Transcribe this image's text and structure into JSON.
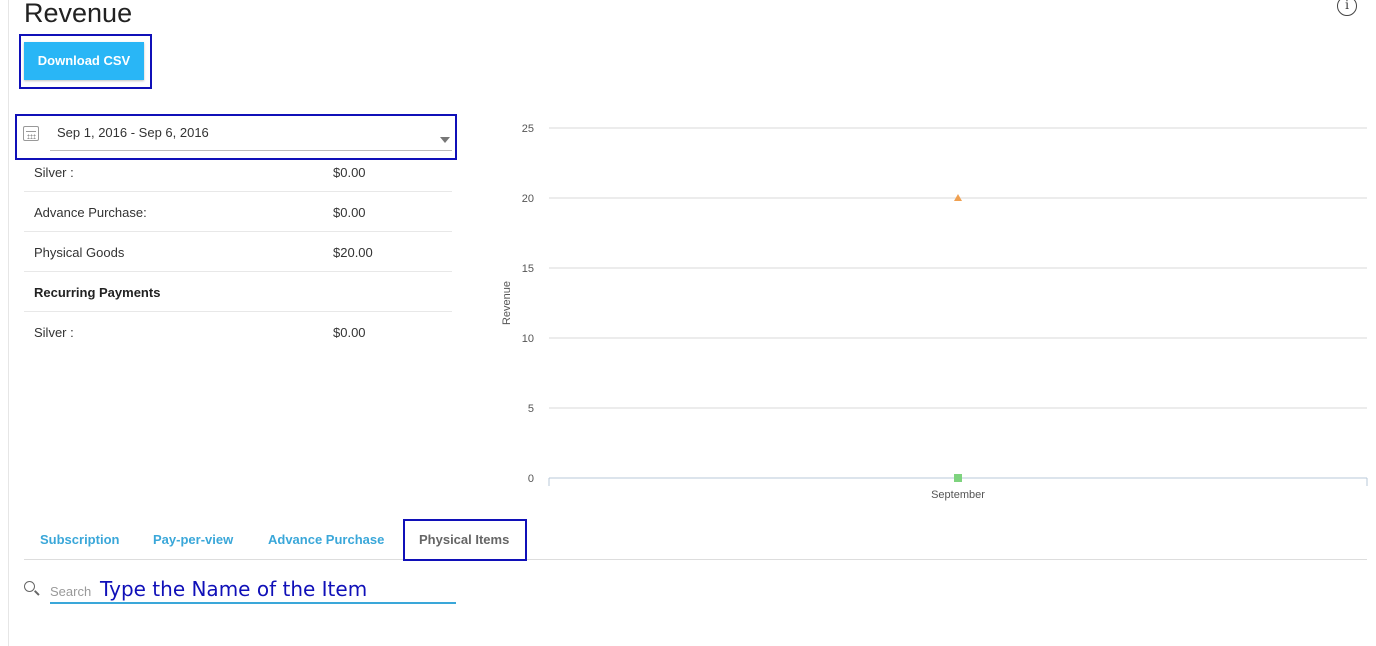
{
  "page": {
    "title": "Revenue",
    "info_glyph": "i"
  },
  "toolbar": {
    "download_label": "Download CSV"
  },
  "date_range": {
    "value": "Sep 1, 2016 - Sep 6, 2016"
  },
  "summary_rows": [
    {
      "label": "Silver :",
      "value": "$0.00"
    },
    {
      "label": "Advance Purchase:",
      "value": "$0.00"
    },
    {
      "label": "Physical Goods",
      "value": "$20.00"
    },
    {
      "label": "Recurring Payments",
      "value": ""
    },
    {
      "label": "Silver :",
      "value": "$0.00"
    }
  ],
  "tabs": [
    {
      "label": "Subscription",
      "active": false
    },
    {
      "label": "Pay-per-view",
      "active": false
    },
    {
      "label": "Advance Purchase",
      "active": false
    },
    {
      "label": "Physical Items",
      "active": true
    }
  ],
  "search": {
    "placeholder": "Search",
    "annotation": "Type the Name of the Item"
  },
  "colors": {
    "accent": "#29b6f6",
    "tab_link": "#3aa7d9",
    "highlight_box": "#1010b8",
    "series_triangle": "#f0a050",
    "series_square": "#7ed37e"
  },
  "chart_data": {
    "type": "scatter",
    "ylabel": "Revenue",
    "xlabel": "",
    "categories": [
      "September"
    ],
    "ylim": [
      0,
      25
    ],
    "yticks": [
      0,
      5,
      10,
      15,
      20,
      25
    ],
    "grid": true,
    "series": [
      {
        "marker": "triangle",
        "color": "#f0a050",
        "values": [
          20
        ]
      },
      {
        "marker": "square",
        "color": "#7ed37e",
        "values": [
          0
        ]
      }
    ]
  }
}
